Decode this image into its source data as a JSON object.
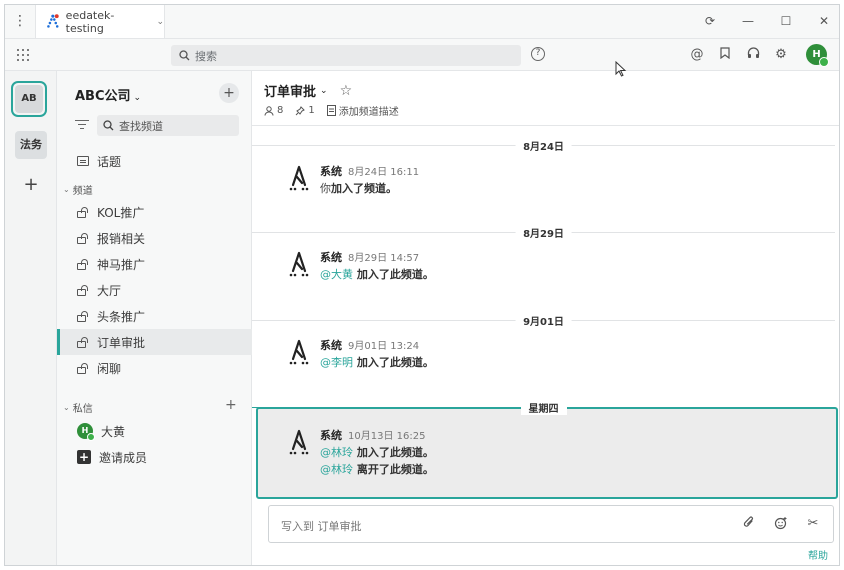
{
  "window": {
    "tab_label": "eedatek-testing",
    "controls": [
      "⟳",
      "—",
      "☐",
      "✕"
    ]
  },
  "toolbar": {
    "search_placeholder": "搜索"
  },
  "teams": [
    {
      "label": "AB",
      "active": true
    },
    {
      "label": "法务",
      "active": false
    }
  ],
  "sidebar": {
    "team_name": "ABC公司",
    "find_placeholder": "查找频道",
    "topics_label": "话题",
    "channels_header": "频道",
    "channels": [
      {
        "label": "KOL推广",
        "active": false
      },
      {
        "label": "报销相关",
        "active": false
      },
      {
        "label": "神马推广",
        "active": false
      },
      {
        "label": "大厅",
        "active": false
      },
      {
        "label": "头条推广",
        "active": false
      },
      {
        "label": "订单审批",
        "active": true
      },
      {
        "label": "闲聊",
        "active": false
      }
    ],
    "dm_header": "私信",
    "dms": [
      {
        "label": "大黄",
        "avatar": "H"
      }
    ],
    "invite_label": "邀请成员"
  },
  "channel": {
    "title": "订单审批",
    "members": "8",
    "pinned": "1",
    "add_desc": "添加频道描述"
  },
  "messages": [
    {
      "date_sep": "8月24日",
      "sender": "系统",
      "time": "8月24日 16:11",
      "lines": [
        {
          "prefix": "你",
          "mention": "",
          "text": "加入了频道。"
        }
      ]
    },
    {
      "date_sep": "8月29日",
      "sender": "系统",
      "time": "8月29日 14:57",
      "lines": [
        {
          "prefix": "",
          "mention": "@大黄",
          "text": " 加入了此频道。"
        }
      ]
    },
    {
      "date_sep": "9月01日",
      "sender": "系统",
      "time": "9月01日 13:24",
      "lines": [
        {
          "prefix": "",
          "mention": "@李明",
          "text": " 加入了此频道。"
        }
      ]
    },
    {
      "date_sep": "星期四",
      "sender": "系统",
      "time": "10月13日 16:25",
      "lines": [
        {
          "prefix": "",
          "mention": "@林玲",
          "text": " 加入了此频道。"
        },
        {
          "prefix": "",
          "mention": "@林玲",
          "text": " 离开了此频道。"
        }
      ]
    }
  ],
  "composer": {
    "placeholder": "写入到 订单审批",
    "help": "帮助"
  },
  "colors": {
    "accent": "#2aa59b",
    "avatar_green": "#2f8f3a"
  }
}
